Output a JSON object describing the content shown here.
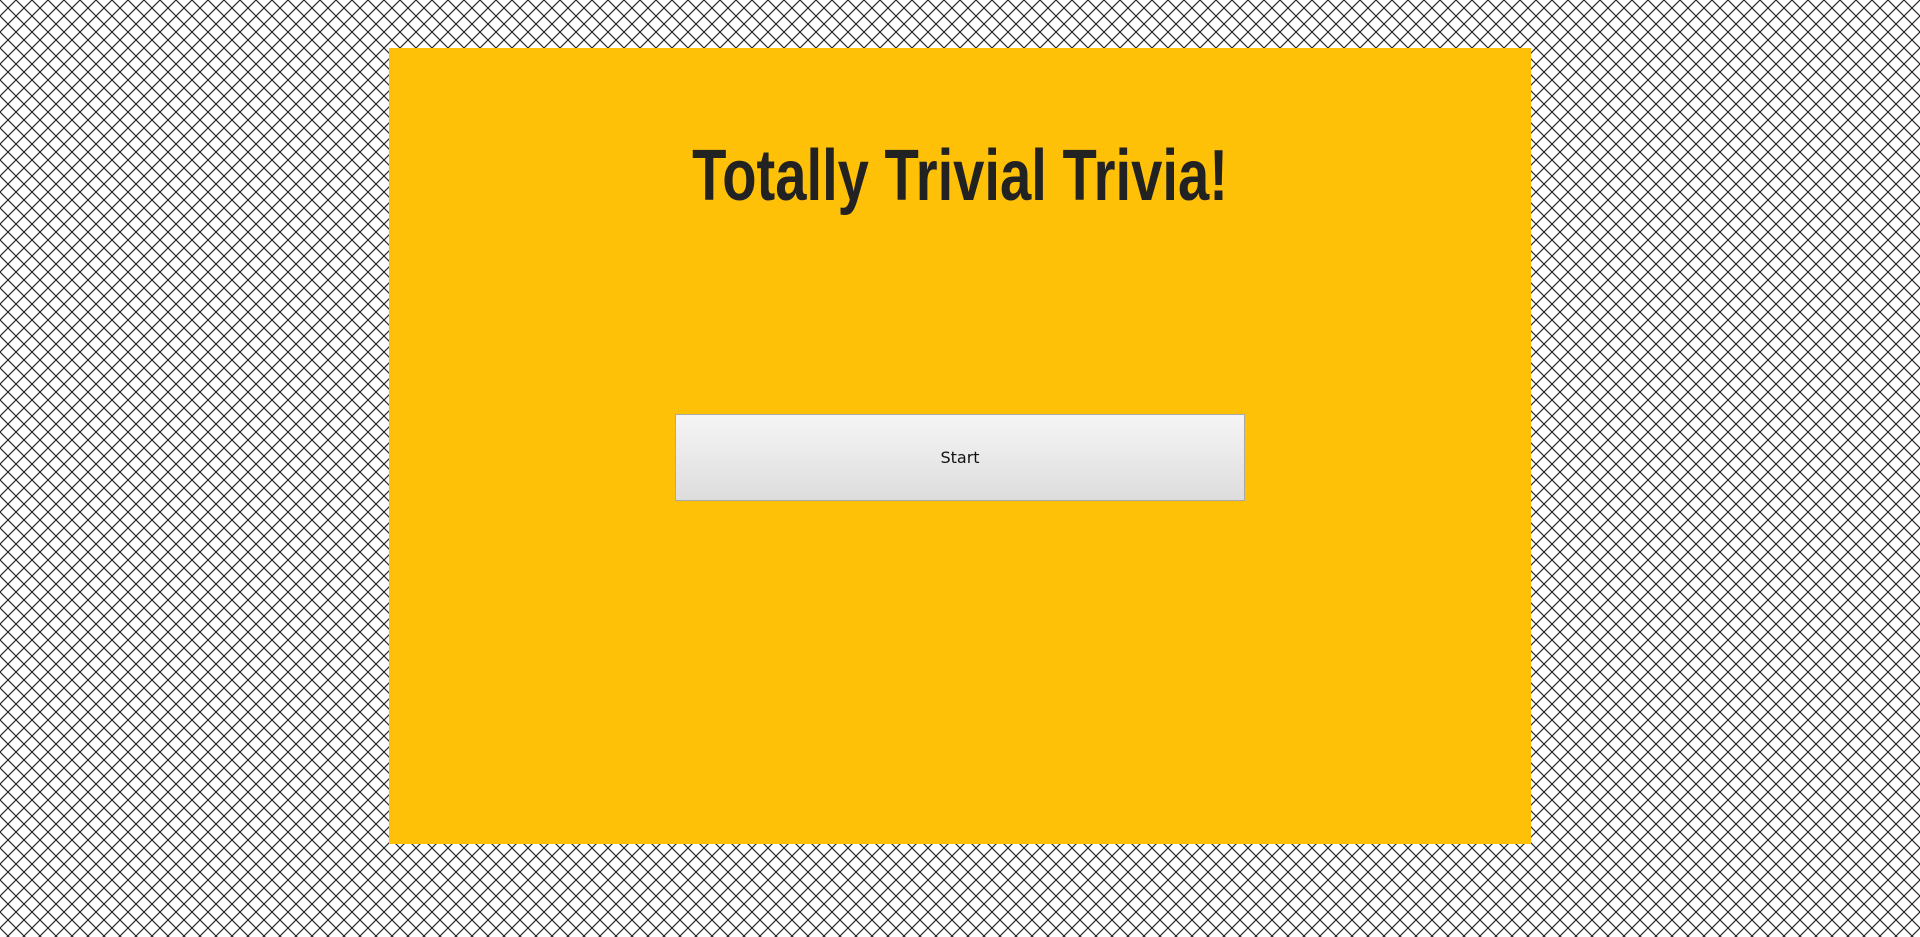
{
  "page": {
    "title": "Totally Trivial Trivia!",
    "background_pattern": "diagonal-crosshatch",
    "panel_color": "#ffc107"
  },
  "controls": {
    "start_label": "Start"
  }
}
